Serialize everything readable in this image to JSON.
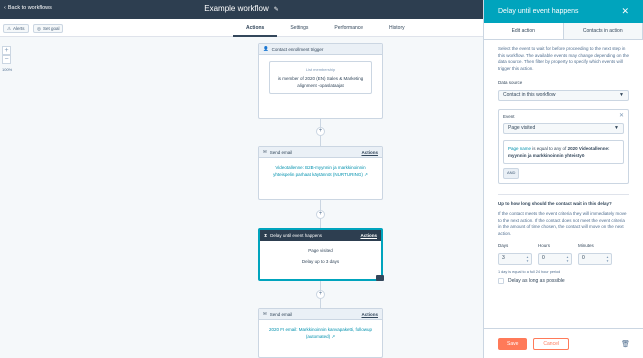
{
  "header": {
    "back_label": "Back to workflows",
    "title": "Example workflow",
    "alerts_label": "Alerts",
    "set_goal_label": "Set goal",
    "tabs": [
      "Actions",
      "Settings",
      "Performance",
      "History"
    ]
  },
  "zoom": {
    "plus": "+",
    "minus": "−",
    "level": "100%"
  },
  "canvas": {
    "trigger": {
      "title": "Contact enrollment trigger",
      "box_label": "List membership",
      "text": "is member of 2020 (EN) Sales & Marketing alignment -opaslataajat"
    },
    "email1": {
      "title": "Send email",
      "actions": "Actions",
      "text": "Videotallenne: B2B-myynnin ja markkinoinnin yhteispelin parhaat käytännöt (NURTURING)"
    },
    "delay": {
      "title": "Delay until event happens",
      "actions": "Actions",
      "event": "Page visited",
      "delay_text": "Delay up to 3 days"
    },
    "email2": {
      "title": "Send email",
      "actions": "Actions",
      "text": "2020 FI email: Markkinoinnin kanvapaketti, followup (automated)"
    }
  },
  "panel": {
    "title": "Delay until event happens",
    "tabs": [
      "Edit action",
      "Contacts in action"
    ],
    "description": "Select the event to wait for before proceeding to the next step in this workflow. The available events may change depending on the data source. Then filter by property to specify which events will trigger this action.",
    "data_source_label": "Data source",
    "data_source_value": "Contact in this workflow",
    "event_label": "Event",
    "event_value": "Page visited",
    "filter_text_1": "Page name",
    "filter_text_2": " is equal to any of ",
    "filter_text_3": "2020 Videotallenne: myynnin ja markkinoinnin yhteistyö",
    "and_label": "AND",
    "wait_question": "Up to how long should the contact wait in this delay?",
    "wait_desc": "If the contact meets the event criteria they will immediately move to the next action. If the contact does not meet the event criteria in the amount of time chosen, the contact will move on the next action.",
    "days_label": "Days",
    "hours_label": "Hours",
    "minutes_label": "Minutes",
    "days_value": "3",
    "hours_value": "0",
    "minutes_value": "0",
    "day_note": "1 day is equal to a full 24 hour period",
    "delay_long_label": "Delay as long as possible",
    "save_label": "Save",
    "cancel_label": "Cancel"
  }
}
